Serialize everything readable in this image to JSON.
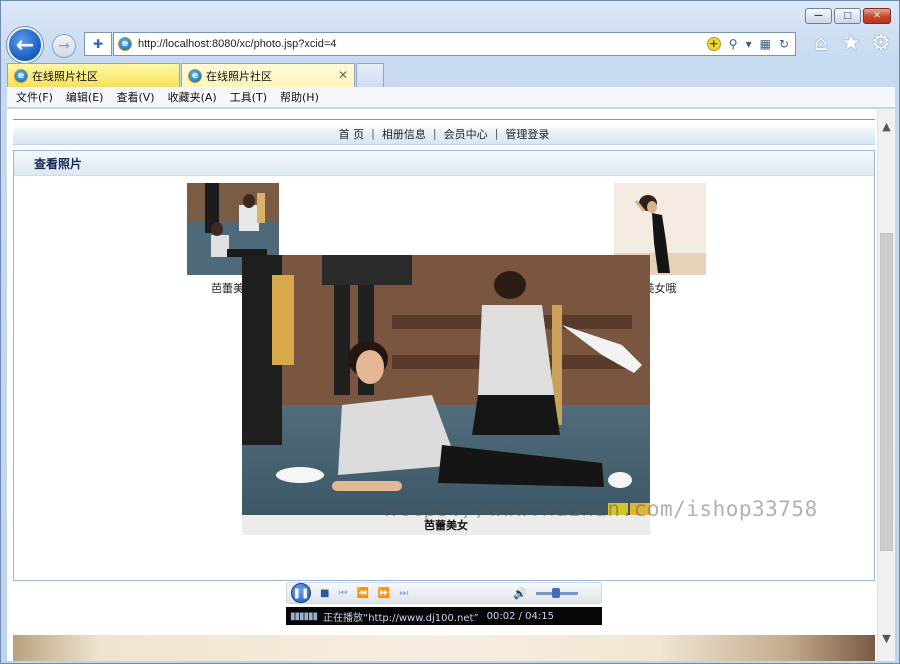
{
  "browser": {
    "address": "http://localhost:8080/xc/photo.jsp?xcid=4",
    "tabs": [
      {
        "label": "在线照片社区"
      },
      {
        "label": "在线照片社区"
      }
    ],
    "menu": [
      "文件(F)",
      "编辑(E)",
      "查看(V)",
      "收藏夹(A)",
      "工具(T)",
      "帮助(H)"
    ]
  },
  "site": {
    "nav": [
      "首 页",
      "相册信息",
      "会员中心",
      "管理登录"
    ],
    "nav_sep": "|",
    "panel_title": "查看照片",
    "thumbnails": [
      {
        "caption": "芭蕾美女"
      },
      {
        "caption": "美女哦"
      }
    ],
    "main_caption": "芭蕾美女"
  },
  "player": {
    "status": "正在播放“http://www.dj100.net”",
    "time": "00:02 / 04:15"
  },
  "watermark": "https://www.huzhan.com/ishop33758"
}
